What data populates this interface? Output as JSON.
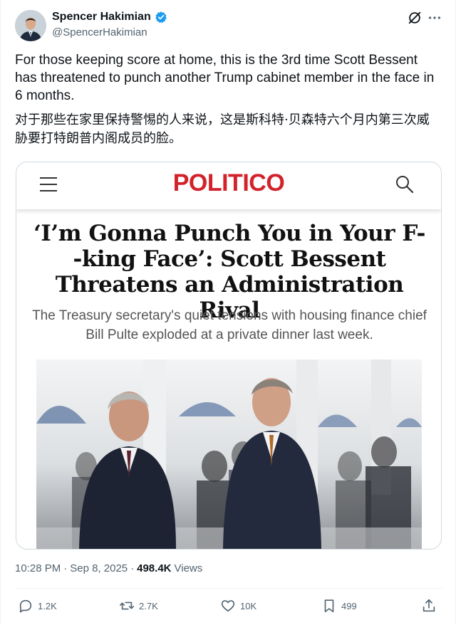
{
  "author": {
    "display_name": "Spencer Hakimian",
    "handle": "@SpencerHakimian",
    "verified": true,
    "verified_color": "#1d9bf0"
  },
  "tweet": {
    "text": "For those keeping score at home, this is the 3rd time Scott Bessent has threatened to punch another Trump cabinet member in the face in 6 months.",
    "translation": "对于那些在家里保持警惕的人来说，这是斯科特·贝森特六个月内第三次威胁要打特朗普内阁成员的脸。"
  },
  "article": {
    "brand": "POLITICO",
    "brand_color": "#d3222a",
    "headline": "‘I’m Gonna Punch You in Your F--king Face’: Scott Bessent Threatens an Administration Rival",
    "subhead": "The Treasury secretary's quiet tensions with housing finance chief Bill Pulte exploded at a private dinner last week."
  },
  "meta": {
    "time": "10:28 PM",
    "separator": "·",
    "date": "Sep 8, 2025",
    "views_count": "498.4K",
    "views_label": "Views"
  },
  "actions": {
    "replies": "1.2K",
    "reposts": "2.7K",
    "likes": "10K",
    "bookmarks": "499"
  },
  "icons": {
    "reply": "reply-icon",
    "repost": "repost-icon",
    "like": "heart-icon",
    "bookmark": "bookmark-icon",
    "share": "share-icon",
    "grok": "grok-icon",
    "more": "more-icon",
    "menu": "hamburger-icon",
    "search": "search-icon"
  },
  "colors": {
    "text_primary": "#0f1419",
    "text_secondary": "#536471",
    "border": "#cfd9de"
  }
}
